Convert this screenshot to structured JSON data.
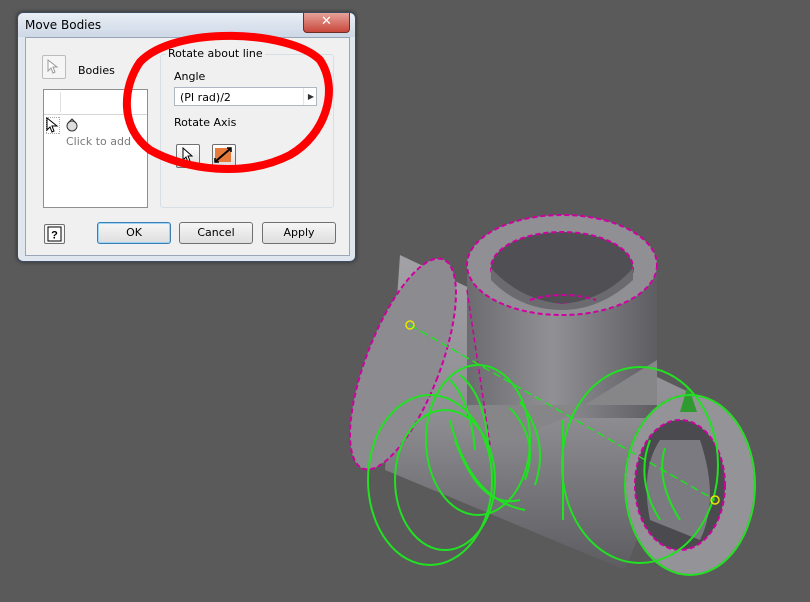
{
  "dialog": {
    "title": "Move Bodies",
    "close_label": "✕",
    "bodies_label": "Bodies",
    "list_placeholder": "Click to add",
    "group_label": "Rotate about line",
    "angle_label": "Angle",
    "angle_value": "(PI rad)/2",
    "rotate_axis_label": "Rotate Axis",
    "help_icon": "?",
    "ok_label": "OK",
    "cancel_label": "Cancel",
    "apply_label": "Apply"
  },
  "colors": {
    "viewport_bg": "#5a5a5a",
    "model_surface": "#8d8d91",
    "edge_highlight": "#d000a0",
    "preview_green": "#22e022",
    "annotation_red": "#ff0000"
  }
}
